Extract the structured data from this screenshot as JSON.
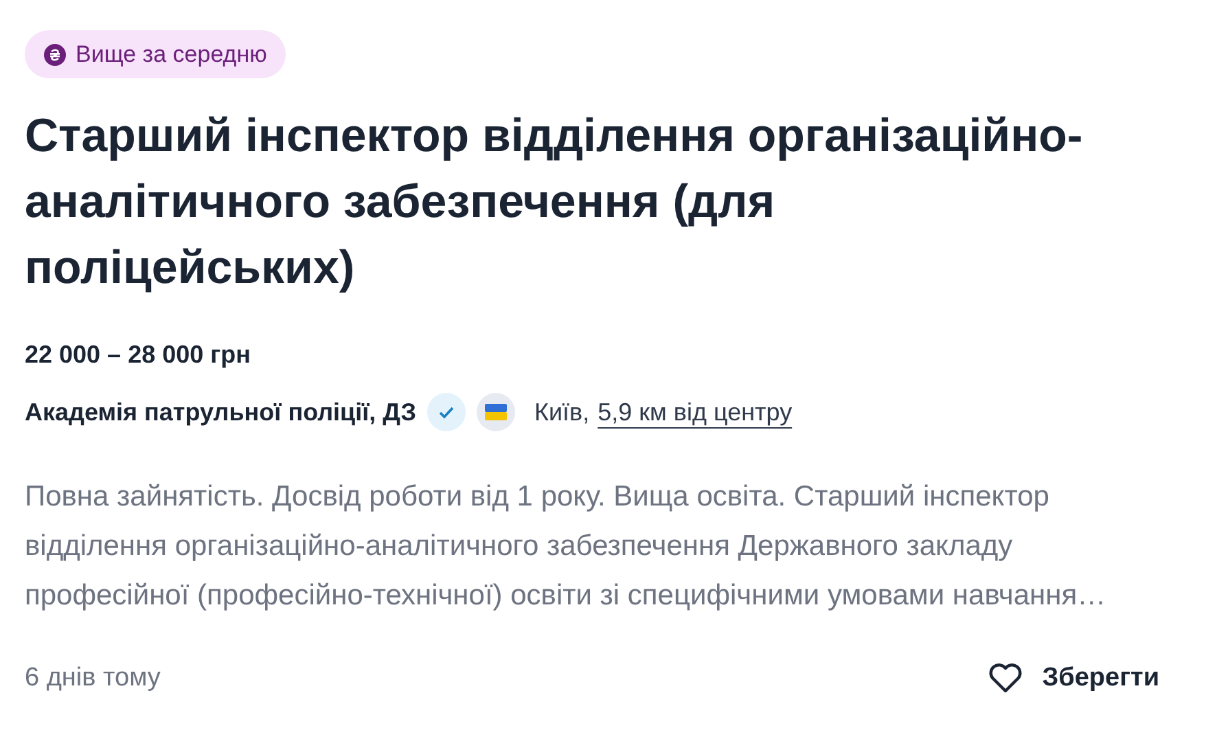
{
  "badge": {
    "label": "Вище за середню"
  },
  "title": "Старший інспектор відділення організаційно-аналітичного забезпечення (для поліцейських)",
  "salary": "22 000 – 28 000 грн",
  "company": {
    "name": "Академія патрульної поліції, ДЗ",
    "verified": true,
    "city": "Київ,",
    "distance": "5,9 км від центру"
  },
  "description": "Повна зайнятість. Досвід роботи від 1 року. Вища освіта. Старший інспектор відділення організаційно-аналітичного забезпечення Державного закладу професійної (професійно-технічної) освіти зі специфічними умовами навчання…",
  "posted": "6 днів тому",
  "save_button": {
    "label": "Зберегти",
    "saved": false
  }
}
